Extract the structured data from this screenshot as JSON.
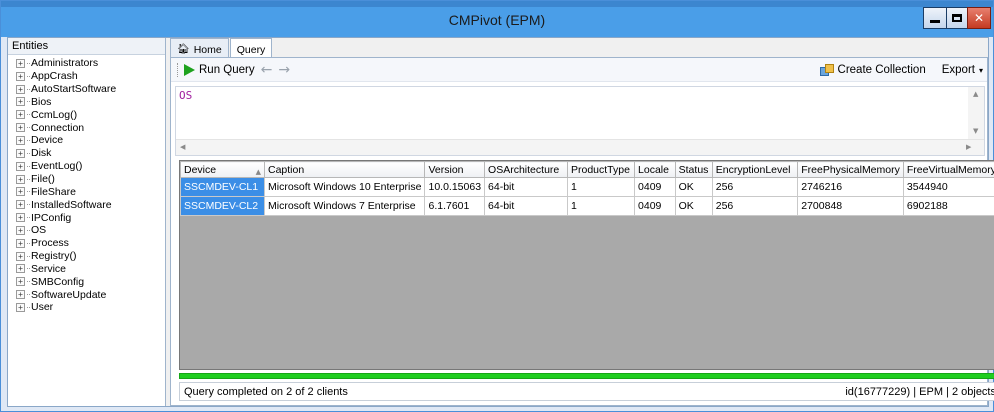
{
  "window": {
    "title": "CMPivot (EPM)"
  },
  "entities": {
    "header": "Entities",
    "items": [
      "Administrators",
      "AppCrash",
      "AutoStartSoftware",
      "Bios",
      "CcmLog()",
      "Connection",
      "Device",
      "Disk",
      "EventLog()",
      "File()",
      "FileShare",
      "InstalledSoftware",
      "IPConfig",
      "OS",
      "Process",
      "Registry()",
      "Service",
      "SMBConfig",
      "SoftwareUpdate",
      "User"
    ]
  },
  "tabs": [
    {
      "label": "Home",
      "icon": "home-icon"
    },
    {
      "label": "Query"
    }
  ],
  "toolbar": {
    "run_label": "Run Query",
    "back_glyph": "←",
    "forward_glyph": "→",
    "create_collection_label": "Create Collection",
    "export_label": "Export"
  },
  "editor": {
    "query": "OS"
  },
  "grid": {
    "columns": [
      "Device",
      "Caption",
      "Version",
      "OSArchitecture",
      "ProductType",
      "Locale",
      "Status",
      "EncryptionLevel",
      "FreePhysicalMemory",
      "FreeVirtualMemory"
    ],
    "rows": [
      [
        "SSCMDEV-CL1",
        "Microsoft Windows 10 Enterprise",
        "10.0.15063",
        "64-bit",
        "1",
        "0409",
        "OK",
        "256",
        "2746216",
        "3544940"
      ],
      [
        "SSCMDEV-CL2",
        "Microsoft Windows 7 Enterprise",
        "6.1.7601",
        "64-bit",
        "1",
        "0409",
        "OK",
        "256",
        "2700848",
        "6902188"
      ]
    ]
  },
  "progress": {
    "percent": 100,
    "color": "#1fce1f"
  },
  "status": {
    "left": "Query completed on 2 of 2 clients",
    "right": "id(16777229)  |  EPM  |  2 objects"
  },
  "colors": {
    "title_bar": "#4a9ee8",
    "selection": "#3b8ee6",
    "query_text": "#a01f9e"
  }
}
